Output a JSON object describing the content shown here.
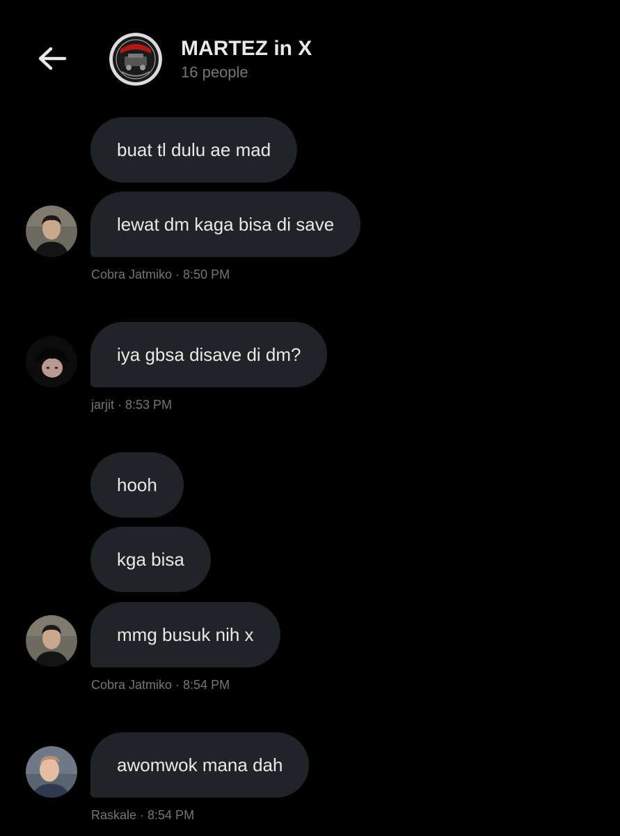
{
  "header": {
    "back_icon": "arrow-left-icon",
    "group_avatar_icon": "martez-logo",
    "title": "MARTEZ in X",
    "subtitle": "16 people"
  },
  "messages": [
    {
      "text": "buat tl dulu ae mad"
    },
    {
      "text": "lewat dm kaga bisa di save"
    },
    {
      "text": "iya gbsa disave di dm?"
    },
    {
      "text": "hooh"
    },
    {
      "text": "kga bisa"
    },
    {
      "text": "mmg busuk nih x"
    },
    {
      "text": "awomwok mana dah"
    }
  ],
  "meta": [
    {
      "label": "Cobra Jatmiko · 8:50 PM"
    },
    {
      "label": "jarjit · 8:53 PM"
    },
    {
      "label": "Cobra Jatmiko · 8:54 PM"
    },
    {
      "label": "Raskale · 8:54 PM"
    }
  ],
  "colors": {
    "background": "#000000",
    "bubble": "#202327",
    "text": "#e7e9ea",
    "muted": "#71767b"
  }
}
